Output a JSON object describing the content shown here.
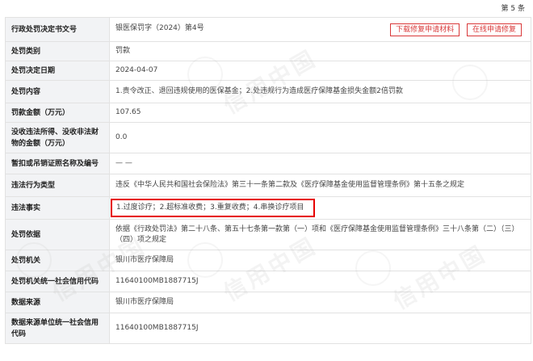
{
  "record_no": "第 5 条",
  "buttons": {
    "download": "下载修复申请材料",
    "online": "在线申请修复"
  },
  "rows": [
    {
      "label": "行政处罚决定书文号",
      "value": "银医保罚字（2024）第4号"
    },
    {
      "label": "处罚类别",
      "value": "罚款"
    },
    {
      "label": "处罚决定日期",
      "value": "2024-04-07"
    },
    {
      "label": "处罚内容",
      "value": "1.责令改正、退回违规使用的医保基金；2.处违规行为造成医疗保障基金损失金额2倍罚款"
    },
    {
      "label": "罚款金额（万元）",
      "value": "107.65"
    },
    {
      "label": "没收违法所得、没收非法财物的金额（万元）",
      "value": "0.0"
    },
    {
      "label": "暂扣或吊销证照名称及编号",
      "value": "— —"
    },
    {
      "label": "违法行为类型",
      "value": "违反《中华人民共和国社会保险法》第三十一条第二款及《医疗保障基金使用监督管理条例》第十五条之规定"
    },
    {
      "label": "违法事实",
      "value": "1.过度诊疗；2.超标准收费；3.重复收费；4.串换诊疗项目"
    },
    {
      "label": "处罚依据",
      "value": "依据《行政处罚法》第二十八条、第五十七条第一款第（一）项和《医疗保障基金使用监督管理条例》三十八条第（二）（三）（四）项之规定"
    },
    {
      "label": "处罚机关",
      "value": "银川市医疗保障局"
    },
    {
      "label": "处罚机关统一社会信用代码",
      "value": "11640100MB1887715J"
    },
    {
      "label": "数据来源",
      "value": "银川市医疗保障局"
    },
    {
      "label": "数据来源单位统一社会信用代码",
      "value": "11640100MB1887715J"
    }
  ],
  "watermark_text": "信用中国"
}
